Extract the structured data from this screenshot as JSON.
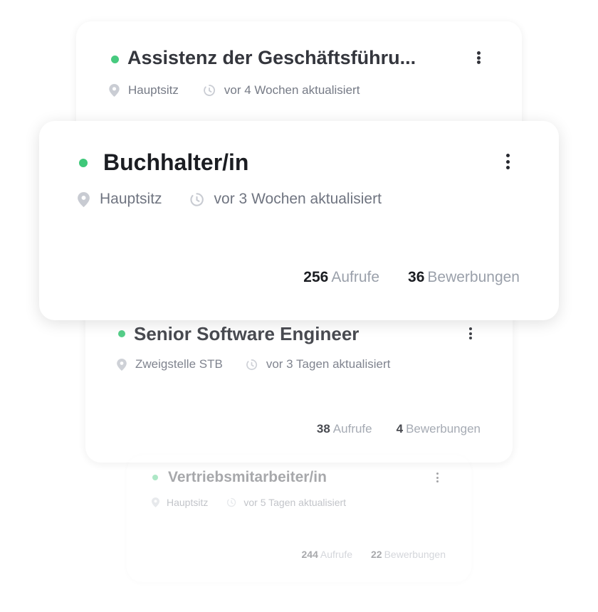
{
  "jobs": [
    {
      "title": "Assistenz der Geschäftsführu...",
      "location": "Hauptsitz",
      "updated": "vor 4 Wochen aktualisiert",
      "status_color": "#3ec879"
    },
    {
      "title": "Buchhalter/in",
      "location": "Hauptsitz",
      "updated": "vor 3 Wochen aktualisiert",
      "views": "256",
      "views_label": "Aufrufe",
      "applications": "36",
      "applications_label": "Bewerbungen",
      "status_color": "#3ec879"
    },
    {
      "title": "Senior Software Engineer",
      "location": "Zweigstelle STB",
      "updated": "vor 3 Tagen aktualisiert",
      "views": "38",
      "views_label": "Aufrufe",
      "applications": "4",
      "applications_label": "Bewerbungen",
      "status_color": "#3ec879"
    },
    {
      "title": "Vertriebsmitarbeiter/in",
      "location": "Hauptsitz",
      "updated": "vor 5 Tagen aktualisiert",
      "views": "244",
      "views_label": "Aufrufe",
      "applications": "22",
      "applications_label": "Bewerbungen",
      "status_color": "#3ec879"
    }
  ],
  "icons": {
    "location": "map-pin-icon",
    "updated": "clock-icon",
    "menu": "more-vertical-icon",
    "status": "status-dot-icon"
  }
}
